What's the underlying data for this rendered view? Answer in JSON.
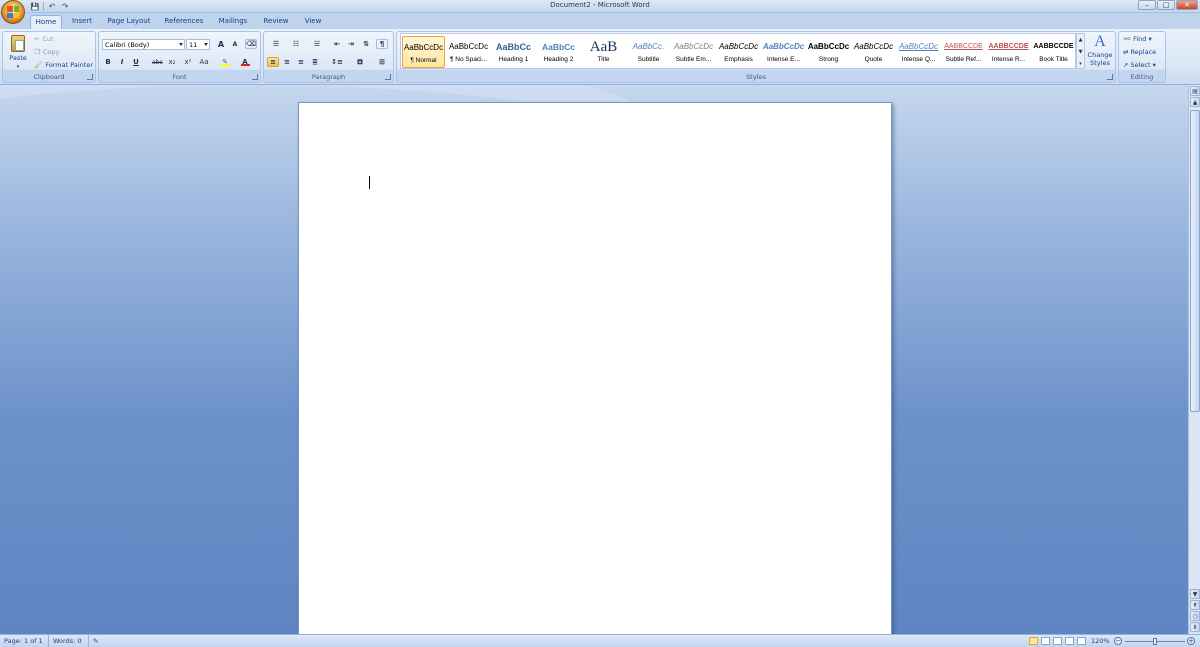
{
  "window": {
    "title": "Document2 - Microsoft Word",
    "controls": {
      "minimize": "–",
      "maximize": "□",
      "close": "✕"
    }
  },
  "quick_access": {
    "save": "💾",
    "undo": "↶",
    "redo": "↷"
  },
  "tabs": [
    {
      "label": "Home",
      "active": true
    },
    {
      "label": "Insert"
    },
    {
      "label": "Page Layout"
    },
    {
      "label": "References"
    },
    {
      "label": "Mailings"
    },
    {
      "label": "Review"
    },
    {
      "label": "View"
    }
  ],
  "clipboard": {
    "label": "Clipboard",
    "paste": "Paste",
    "cut": "Cut",
    "copy": "Copy",
    "format_painter": "Format Painter"
  },
  "font": {
    "label": "Font",
    "family": "Calibri (Body)",
    "size": "11",
    "buttons": {
      "bold": "B",
      "italic": "I",
      "underline": "U",
      "strike": "abc",
      "subscript": "x₂",
      "superscript": "x²",
      "change_case": "Aa",
      "grow": "A",
      "shrink": "A"
    }
  },
  "paragraph": {
    "label": "Paragraph",
    "pilcrow": "¶"
  },
  "styles": {
    "label": "Styles",
    "items": [
      {
        "preview": "AaBbCcDc",
        "name": "¶ Normal",
        "selected": true
      },
      {
        "preview": "AaBbCcDc",
        "name": "¶ No Spaci..."
      },
      {
        "preview": "AaBbCc",
        "name": "Heading 1"
      },
      {
        "preview": "AaBbCc",
        "name": "Heading 2"
      },
      {
        "preview": "AaB",
        "name": "Title"
      },
      {
        "preview": "AaBbCc.",
        "name": "Subtitle"
      },
      {
        "preview": "AaBbCcDc",
        "name": "Subtle Em..."
      },
      {
        "preview": "AaBbCcDc",
        "name": "Emphasis"
      },
      {
        "preview": "AaBbCcDc",
        "name": "Intense E..."
      },
      {
        "preview": "AaBbCcDc",
        "name": "Strong"
      },
      {
        "preview": "AaBbCcDc",
        "name": "Quote"
      },
      {
        "preview": "AaBbCcDc",
        "name": "Intense Q..."
      },
      {
        "preview": "AABBCCDE",
        "name": "Subtle Ref..."
      },
      {
        "preview": "AABBCCDE",
        "name": "Intense R..."
      },
      {
        "preview": "AABBCCDE",
        "name": "Book Title"
      }
    ],
    "change_styles": "Change Styles"
  },
  "editing": {
    "label": "Editing",
    "find": "Find",
    "replace": "Replace",
    "select": "Select"
  },
  "status": {
    "page": "Page: 1 of 1",
    "words": "Words: 0",
    "zoom": "120%",
    "zoom_minus": "−",
    "zoom_plus": "+"
  },
  "colors": {
    "ribbon": "#dde8f6",
    "workspace": "#6d92ca",
    "accent_orange": "#e8a640",
    "font_color_red": "#e02020",
    "highlight_yellow": "#ffff00"
  }
}
